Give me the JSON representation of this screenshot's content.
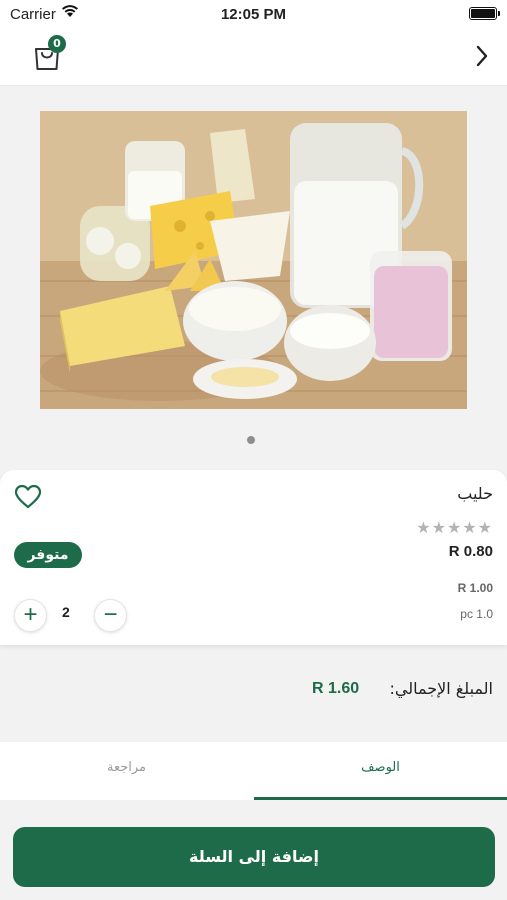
{
  "status_bar": {
    "carrier": "Carrier",
    "time": "12:05 PM"
  },
  "header": {
    "cart_count": "0",
    "cart_icon": "shopping-bag-icon",
    "next_icon": "chevron-right-icon"
  },
  "gallery": {
    "image": "dairy-products-photo",
    "pages": 1,
    "current_page": 1
  },
  "product": {
    "name": "حليب",
    "rating": 0,
    "rating_max": 5,
    "price": "R 0.80",
    "availability": "متوفر",
    "old_price": "R 1.00",
    "unit": "pc 1.0",
    "quantity": "2",
    "plus": "+",
    "minus": "−"
  },
  "total": {
    "label": "المبلغ الإجمالي:",
    "value": "R 1.60"
  },
  "tabs": [
    {
      "label": "الوصف",
      "active": true
    },
    {
      "label": "مراجعة",
      "active": false
    }
  ],
  "add_to_cart": "إضافة إلى السلة",
  "colors": {
    "brand": "#1e6b4a",
    "star_empty": "#b3b3b3"
  }
}
